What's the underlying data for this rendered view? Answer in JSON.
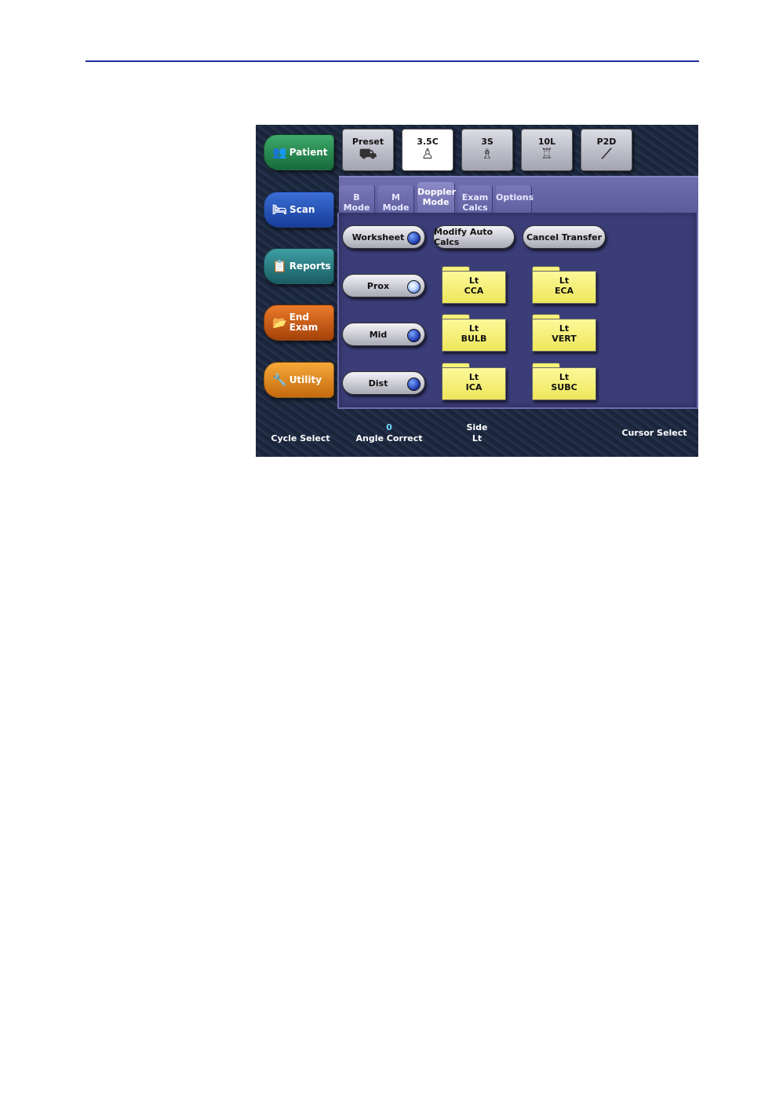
{
  "nav": {
    "patient": "Patient",
    "scan": "Scan",
    "reports": "Reports",
    "end_line1": "End",
    "end_line2": "Exam",
    "utility": "Utility"
  },
  "probes": {
    "preset": "Preset",
    "p1": "3.5C",
    "p2": "3S",
    "p3": "10L",
    "p4": "P2D"
  },
  "tabs": {
    "bmode": "B Mode",
    "mmode": "M Mode",
    "doppler_line1": "Doppler",
    "doppler_line2": "Mode",
    "exam_line1": "Exam",
    "exam_line2": "Calcs",
    "options": "Options"
  },
  "actions": {
    "worksheet": "Worksheet",
    "modify": "Modify Auto Calcs",
    "cancel": "Cancel Transfer"
  },
  "locations": {
    "prox": "Prox",
    "mid": "Mid",
    "dist": "Dist"
  },
  "folders": [
    {
      "side": "Lt",
      "vessel": "CCA"
    },
    {
      "side": "Lt",
      "vessel": "ECA"
    },
    {
      "side": "Lt",
      "vessel": "BULB"
    },
    {
      "side": "Lt",
      "vessel": "VERT"
    },
    {
      "side": "Lt",
      "vessel": "ICA"
    },
    {
      "side": "Lt",
      "vessel": "SUBC"
    }
  ],
  "bottom": {
    "cycle": "Cycle Select",
    "angle_value": "0",
    "angle_label": "Angle Correct",
    "side_label": "Side",
    "side_value": "Lt",
    "cursor": "Cursor Select"
  }
}
